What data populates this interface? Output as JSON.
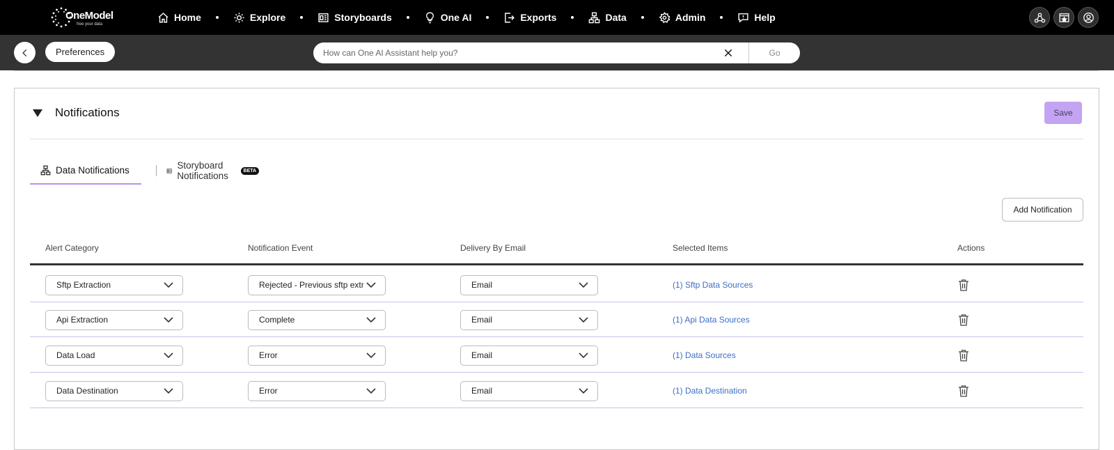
{
  "brand": {
    "name": "OneModel",
    "tagline": "free your data"
  },
  "nav": {
    "items": [
      {
        "label": "Home",
        "icon": "home-icon"
      },
      {
        "label": "Explore",
        "icon": "explore-icon"
      },
      {
        "label": "Storyboards",
        "icon": "storyboards-icon"
      },
      {
        "label": "One AI",
        "icon": "lightbulb-icon"
      },
      {
        "label": "Exports",
        "icon": "export-icon"
      },
      {
        "label": "Data",
        "icon": "data-icon"
      },
      {
        "label": "Admin",
        "icon": "gear-icon"
      },
      {
        "label": "Help",
        "icon": "help-icon"
      }
    ],
    "right_icons": [
      "network-icon",
      "dashboard-star-icon",
      "user-icon"
    ]
  },
  "subbar": {
    "back_icon": "chevron-left-icon",
    "breadcrumb": "Preferences",
    "search_placeholder": "How can One AI Assistant help you?",
    "go_label": "Go"
  },
  "section": {
    "title": "Notifications",
    "save_label": "Save",
    "tabs": [
      {
        "label": "Data Notifications",
        "active": true,
        "icon": "data-icon"
      },
      {
        "label": "Storyboard Notifications",
        "active": false,
        "icon": "storyboards-icon",
        "badge": "BETA"
      }
    ],
    "add_label": "Add Notification"
  },
  "table": {
    "headers": [
      "Alert Category",
      "Notification Event",
      "Delivery By Email",
      "Selected Items",
      "Actions"
    ],
    "rows": [
      {
        "category": "Sftp Extraction",
        "event": "Rejected - Previous sftp extraction",
        "delivery": "Email",
        "items": "(1) Sftp Data Sources"
      },
      {
        "category": "Api Extraction",
        "event": "Complete",
        "delivery": "Email",
        "items": "(1) Api Data Sources"
      },
      {
        "category": "Data Load",
        "event": "Error",
        "delivery": "Email",
        "items": "(1) Data Sources"
      },
      {
        "category": "Data Destination",
        "event": "Error",
        "delivery": "Email",
        "items": "(1) Data Destination"
      }
    ]
  },
  "colors": {
    "accent": "#b394e8",
    "save_bg": "#c3a4f2",
    "link": "#3c6fc4",
    "nav_bg": "#000000",
    "subbar_bg": "#333333"
  }
}
